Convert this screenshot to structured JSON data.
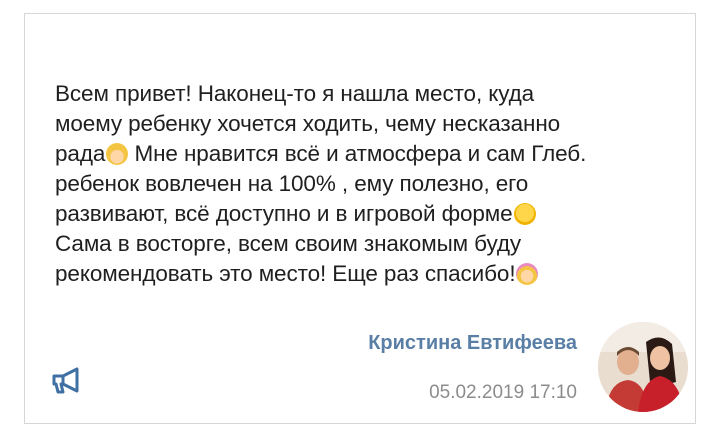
{
  "review": {
    "lines": [
      "Всем привет! Наконец-то я нашла место, куда",
      "моему ребенку хочется ходить, чему несказанно",
      "рада",
      "Мне нравится всё и атмосфера и сам Глеб.",
      "ребенок вовлечен на 100% , ему полезно, его",
      "развивают, всё доступно и в игровой форме",
      "Сама в восторге, всем своим знакомым буду",
      "рекомендовать это место! Еще раз спасибо!"
    ],
    "emojis": [
      "woman-gesturing-ok-emoji",
      "zany-face-emoji",
      "woman-tipping-hand-emoji"
    ]
  },
  "author": {
    "name": "Кристина Евтифеева"
  },
  "meta": {
    "timestamp": "05.02.2019 17:10"
  },
  "icons": {
    "megaphone": "megaphone-icon",
    "avatar": "avatar-photo"
  },
  "colors": {
    "author_name": "#5a7fa6",
    "megaphone": "#3f6fa3",
    "timestamp": "#8c8c8c",
    "text": "#1f1f1f"
  }
}
